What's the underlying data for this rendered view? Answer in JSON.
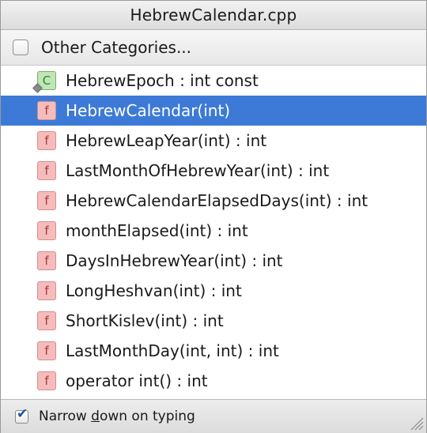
{
  "window": {
    "title": "HebrewCalendar.cpp"
  },
  "categories": {
    "label": "Other Categories...",
    "checked": false
  },
  "members": [
    {
      "icon": "class-constant-icon",
      "kind": "C",
      "label": "HebrewEpoch : int const",
      "selected": false
    },
    {
      "icon": "function-icon",
      "kind": "f",
      "label": "HebrewCalendar(int)",
      "selected": true
    },
    {
      "icon": "function-icon",
      "kind": "f",
      "label": "HebrewLeapYear(int) : int",
      "selected": false
    },
    {
      "icon": "function-icon",
      "kind": "f",
      "label": "LastMonthOfHebrewYear(int) : int",
      "selected": false
    },
    {
      "icon": "function-icon",
      "kind": "f",
      "label": "HebrewCalendarElapsedDays(int) : int",
      "selected": false
    },
    {
      "icon": "function-icon",
      "kind": "f",
      "label": "monthElapsed(int) : int",
      "selected": false
    },
    {
      "icon": "function-icon",
      "kind": "f",
      "label": "DaysInHebrewYear(int) : int",
      "selected": false
    },
    {
      "icon": "function-icon",
      "kind": "f",
      "label": "LongHeshvan(int) : int",
      "selected": false
    },
    {
      "icon": "function-icon",
      "kind": "f",
      "label": "ShortKislev(int) : int",
      "selected": false
    },
    {
      "icon": "function-icon",
      "kind": "f",
      "label": "LastMonthDay(int, int) : int",
      "selected": false
    },
    {
      "icon": "function-icon",
      "kind": "f",
      "label": "operator int() : int",
      "selected": false
    }
  ],
  "footer": {
    "narrow_before": "Narrow ",
    "narrow_mnemonic": "d",
    "narrow_after": "own on typing",
    "narrow_checked": true,
    "check_glyph": "✔"
  },
  "colors": {
    "selection": "#3d7ad7",
    "function_icon_bg": "#f6bcbc",
    "class_icon_bg": "#bfe6b5"
  }
}
